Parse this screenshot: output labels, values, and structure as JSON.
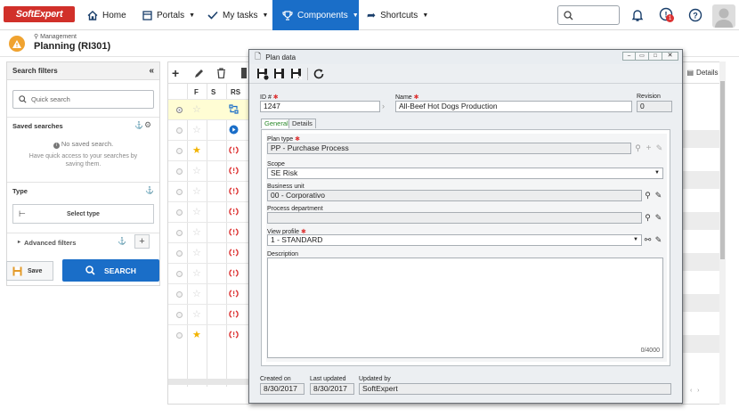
{
  "logo": {
    "text": "SoftExpert"
  },
  "nav": {
    "items": [
      {
        "label": "Home"
      },
      {
        "label": "Portals"
      },
      {
        "label": "My tasks"
      },
      {
        "label": "Components"
      },
      {
        "label": "Shortcuts"
      }
    ],
    "notification_badge": "1"
  },
  "header": {
    "breadcrumb": "Management",
    "title": "Planning (RI301)"
  },
  "search_panel": {
    "title": "Search filters",
    "quick_search_placeholder": "Quick search",
    "saved_searches_label": "Saved searches",
    "no_saved_title": "No saved search.",
    "no_saved_desc": "Have quick access to your searches by saving them.",
    "type_label": "Type",
    "select_type_button": "Select type",
    "advanced_filters_label": "Advanced filters",
    "save_button": "Save",
    "search_button": "SEARCH"
  },
  "grid": {
    "columns": [
      "F",
      "S",
      "RS"
    ],
    "rows": [
      {
        "selected": true,
        "starred": false,
        "status_icon": "transfer-icon"
      },
      {
        "selected": false,
        "starred": false,
        "status_icon": "play-icon"
      },
      {
        "selected": false,
        "starred": true,
        "status_icon": "warning-red-icon"
      },
      {
        "selected": false,
        "starred": false,
        "status_icon": "warning-red-icon"
      },
      {
        "selected": false,
        "starred": false,
        "status_icon": "warning-red-icon"
      },
      {
        "selected": false,
        "starred": false,
        "status_icon": "warning-red-icon"
      },
      {
        "selected": false,
        "starred": false,
        "status_icon": "warning-red-icon"
      },
      {
        "selected": false,
        "starred": false,
        "status_icon": "warning-red-icon"
      },
      {
        "selected": false,
        "starred": false,
        "status_icon": "warning-red-icon"
      },
      {
        "selected": false,
        "starred": false,
        "status_icon": "warning-red-icon"
      },
      {
        "selected": false,
        "starred": false,
        "status_icon": "warning-red-icon"
      },
      {
        "selected": false,
        "starred": true,
        "status_icon": "warning-red-icon"
      }
    ]
  },
  "right_panel": {
    "details_tab": "Details"
  },
  "dialog": {
    "title": "Plan data",
    "id_label": "ID #",
    "id_value": "1247",
    "name_label": "Name",
    "name_value": "All-Beef Hot Dogs Production",
    "revision_label": "Revision",
    "revision_value": "0",
    "tabs": [
      "General",
      "Details"
    ],
    "plan_type_label": "Plan type",
    "plan_type_value": "PP - Purchase Process",
    "scope_label": "Scope",
    "scope_value": "SE Risk",
    "business_unit_label": "Business unit",
    "business_unit_value": "00 - Corporativo",
    "process_department_label": "Process department",
    "process_department_value": "",
    "view_profile_label": "View profile",
    "view_profile_value": "1 - STANDARD",
    "description_label": "Description",
    "description_counter": "0/4000",
    "created_on_label": "Created on",
    "created_on_value": "8/30/2017",
    "last_updated_label": "Last updated",
    "last_updated_value": "8/30/2017",
    "updated_by_label": "Updated by",
    "updated_by_value": "SoftExpert"
  },
  "colors": {
    "accent": "#1a6ec8",
    "brand": "#d1302a",
    "required": "#dd3333",
    "star": "#f2b300"
  }
}
